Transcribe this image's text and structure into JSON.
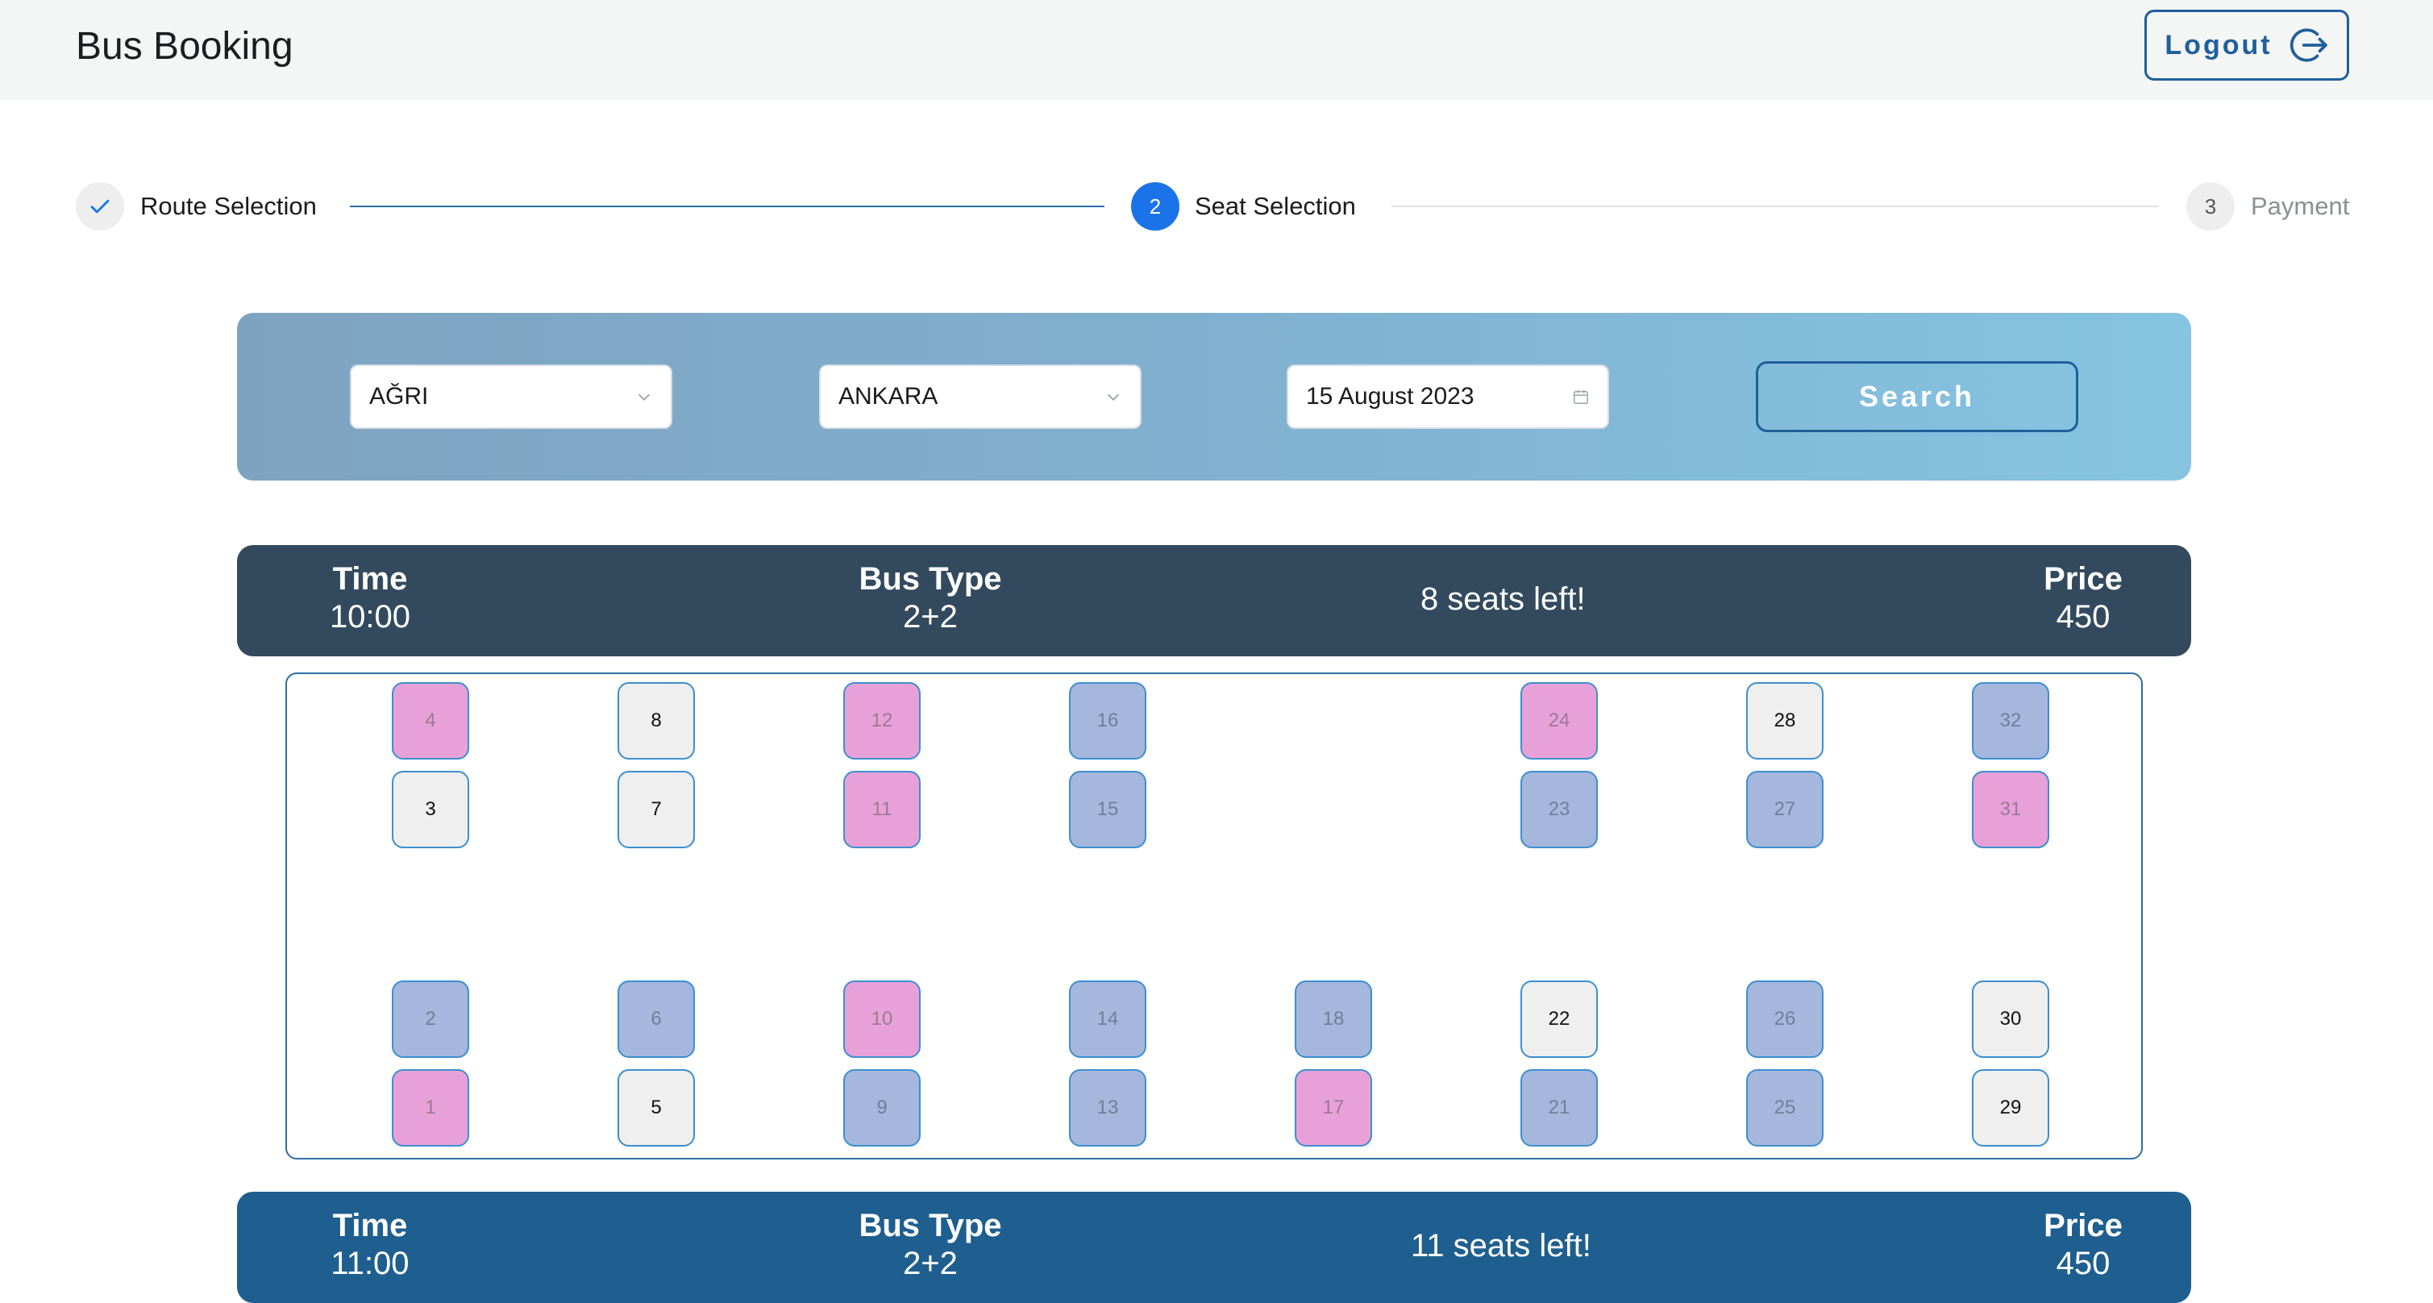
{
  "header": {
    "title": "Bus Booking",
    "logout_label": "Logout"
  },
  "stepper": {
    "steps": [
      {
        "label": "Route Selection",
        "state": "completed"
      },
      {
        "label": "Seat Selection",
        "number": "2",
        "state": "active"
      },
      {
        "label": "Payment",
        "number": "3",
        "state": "pending"
      }
    ]
  },
  "search": {
    "from": "AĞRI",
    "to": "ANKARA",
    "date": "15 August 2023",
    "button_label": "Search"
  },
  "trips": [
    {
      "time_label": "Time",
      "time": "10:00",
      "bus_type_label": "Bus Type",
      "bus_type": "2+2",
      "seats_left": "8 seats left!",
      "price_label": "Price",
      "price": "450"
    },
    {
      "time_label": "Time",
      "time": "11:00",
      "bus_type_label": "Bus Type",
      "bus_type": "2+2",
      "seats_left": "11 seats left!",
      "price_label": "Price",
      "price": "450"
    }
  ],
  "seat_map": {
    "legend_states": [
      "available",
      "taken-m",
      "taken-f"
    ],
    "seats": [
      {
        "n": "4",
        "state": "taken-f"
      },
      {
        "n": "8",
        "state": "available"
      },
      {
        "n": "12",
        "state": "taken-f"
      },
      {
        "n": "16",
        "state": "taken-m"
      },
      {
        "n": "24",
        "state": "taken-f"
      },
      {
        "n": "28",
        "state": "available"
      },
      {
        "n": "32",
        "state": "taken-m"
      },
      {
        "n": "3",
        "state": "available"
      },
      {
        "n": "7",
        "state": "available"
      },
      {
        "n": "11",
        "state": "taken-f"
      },
      {
        "n": "15",
        "state": "taken-m"
      },
      {
        "n": "23",
        "state": "taken-m"
      },
      {
        "n": "27",
        "state": "taken-m"
      },
      {
        "n": "31",
        "state": "taken-f"
      },
      {
        "n": "2",
        "state": "taken-m"
      },
      {
        "n": "6",
        "state": "taken-m"
      },
      {
        "n": "10",
        "state": "taken-f"
      },
      {
        "n": "14",
        "state": "taken-m"
      },
      {
        "n": "18",
        "state": "taken-m"
      },
      {
        "n": "22",
        "state": "available"
      },
      {
        "n": "26",
        "state": "taken-m"
      },
      {
        "n": "30",
        "state": "available"
      },
      {
        "n": "1",
        "state": "taken-f"
      },
      {
        "n": "5",
        "state": "available"
      },
      {
        "n": "9",
        "state": "taken-m"
      },
      {
        "n": "13",
        "state": "taken-m"
      },
      {
        "n": "17",
        "state": "taken-f"
      },
      {
        "n": "21",
        "state": "taken-m"
      },
      {
        "n": "25",
        "state": "taken-m"
      },
      {
        "n": "29",
        "state": "available"
      }
    ]
  },
  "colors": {
    "accent": "#1f5f9b",
    "step_active": "#1a73e8",
    "trip_bar_selected": "#334a5e",
    "trip_bar": "#1f5f8f"
  }
}
